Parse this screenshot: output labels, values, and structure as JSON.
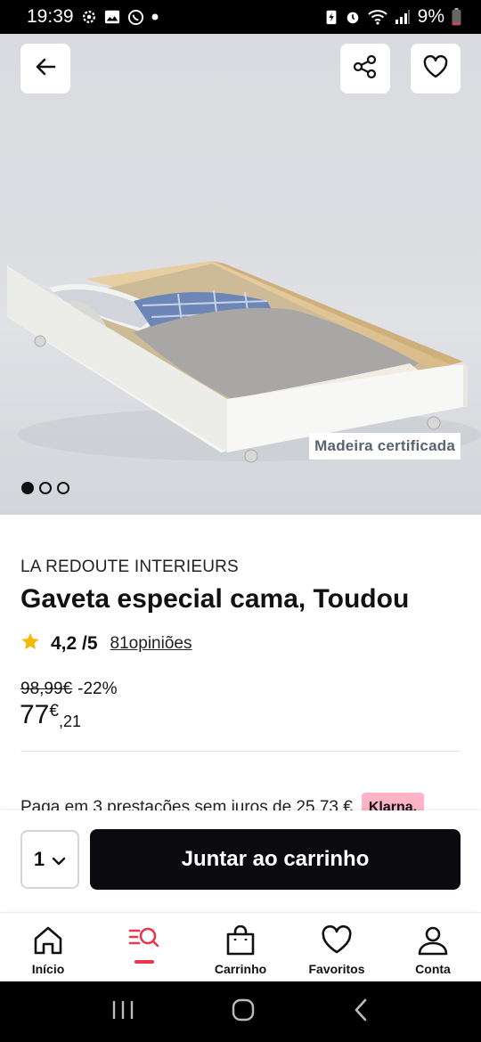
{
  "status_bar": {
    "time": "19:39",
    "battery": "9%",
    "left_icons": [
      "settings-icon",
      "gallery-icon",
      "whatsapp-icon",
      "dot-icon"
    ],
    "right_icons": [
      "battery-saver-icon",
      "alarm-icon",
      "wifi-icon",
      "signal-icon",
      "battery-icon"
    ]
  },
  "hero": {
    "badge": "Madeira certificada",
    "carousel_count": 3,
    "carousel_active": 1,
    "buttons": [
      "back-icon",
      "share-icon",
      "heart-icon"
    ]
  },
  "product": {
    "brand": "LA REDOUTE INTERIEURS",
    "title": "Gaveta especial cama, Toudou",
    "rating": "4,2 /5",
    "reviews": "81opiniões",
    "old_price": "98,99€",
    "discount": "-22%",
    "price_int": "77",
    "price_currency": "€",
    "price_cents": ",21"
  },
  "klarna": {
    "text": "Paga em 3 prestações sem juros de 25,73 €",
    "badge": "Klarna."
  },
  "cart": {
    "quantity": "1",
    "add_label": "Juntar ao carrinho"
  },
  "bottom_nav": {
    "items": [
      {
        "label": "Início",
        "icon": "home-icon"
      },
      {
        "label": "",
        "icon": "search-menu-icon"
      },
      {
        "label": "Carrinho",
        "icon": "bag-icon"
      },
      {
        "label": "Favoritos",
        "icon": "heart-icon"
      },
      {
        "label": "Conta",
        "icon": "user-icon"
      }
    ]
  },
  "colors": {
    "accent": "#e8384f",
    "star": "#f5b800",
    "button": "#0b0b0f",
    "klarna": "#ffb3c7"
  }
}
